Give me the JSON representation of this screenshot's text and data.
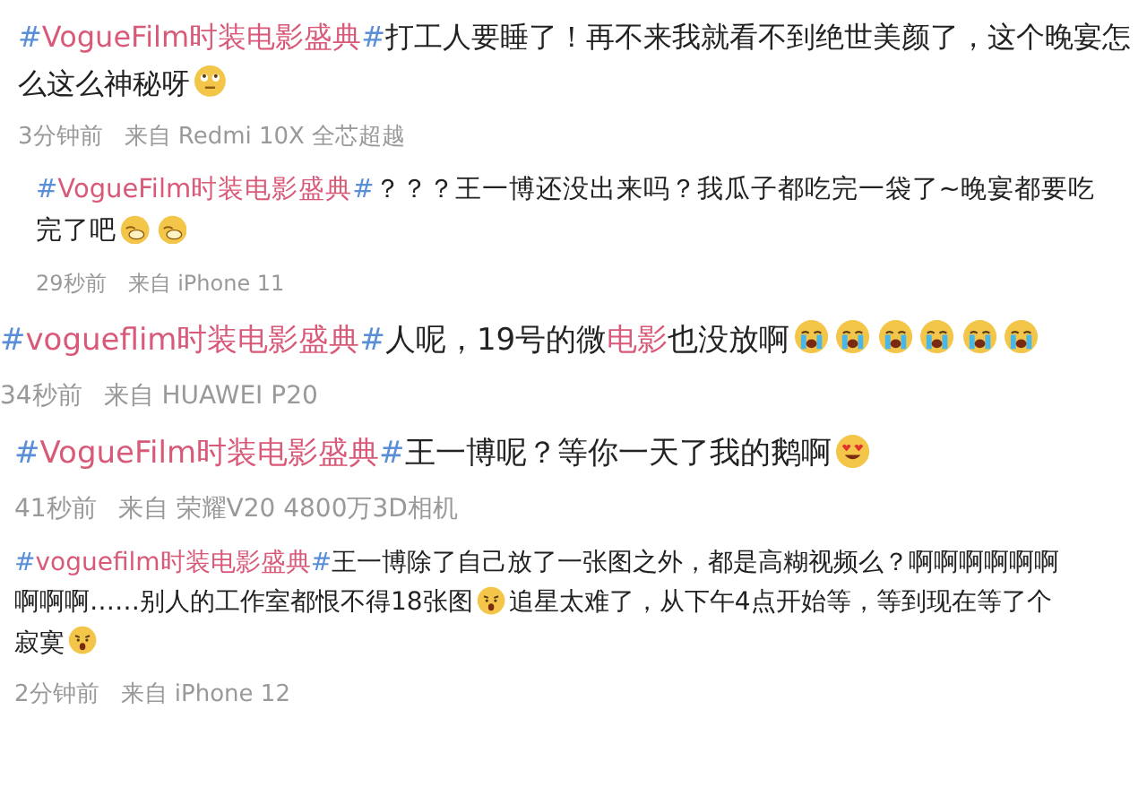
{
  "posts": [
    {
      "body": [
        {
          "kind": "tag",
          "text": "#VogueFilm时装电影盛典#"
        },
        {
          "kind": "text",
          "text": "打工人要睡了！再不来我就看不到绝世美颜了，这个晚宴怎么这么神秘呀"
        },
        {
          "kind": "doubt"
        }
      ],
      "time": "3分钟前",
      "source": "来自 Redmi 10X 全芯超越"
    },
    {
      "body": [
        {
          "kind": "tag",
          "text": "#VogueFilm时装电影盛典#"
        },
        {
          "kind": "text",
          "text": "？？？王一博还没出来吗？我瓜子都吃完一袋了~晚宴都要吃完了吧"
        },
        {
          "kind": "sad"
        },
        {
          "kind": "sad"
        }
      ],
      "time": "29秒前",
      "source": "来自 iPhone 11"
    },
    {
      "body": [
        {
          "kind": "tag",
          "text": "#vogueflim时装电影盛典#"
        },
        {
          "kind": "text",
          "text": "人呢，19号的微"
        },
        {
          "kind": "keyword",
          "text": "电影"
        },
        {
          "kind": "text",
          "text": "也没放啊"
        },
        {
          "kind": "crying"
        },
        {
          "kind": "crying"
        },
        {
          "kind": "crying"
        },
        {
          "kind": "crying"
        },
        {
          "kind": "crying"
        },
        {
          "kind": "crying"
        }
      ],
      "time": "34秒前",
      "source": "来自 HUAWEI P20"
    },
    {
      "body": [
        {
          "kind": "tag",
          "text": "#VogueFilm时装电影盛典#"
        },
        {
          "kind": "text",
          "text": "王一博呢？等你一天了我的鹅啊"
        },
        {
          "kind": "love"
        }
      ],
      "time": "41秒前",
      "source": "来自 荣耀V20 4800万3D相机"
    },
    {
      "body": [
        {
          "kind": "tag",
          "text": "#voguefilm时装电影盛典#"
        },
        {
          "kind": "text",
          "text": "王一博除了自己放了一张图之外，都是高糊视频么？啊啊啊啊啊啊啊啊啊……别人的工作室都恨不得18张图"
        },
        {
          "kind": "upset"
        },
        {
          "kind": "text",
          "text": "追星太难了，从下午4点开始等，等到现在等了个寂寞"
        },
        {
          "kind": "upset"
        }
      ],
      "time": "2分钟前",
      "source": "来自 iPhone 12"
    }
  ]
}
